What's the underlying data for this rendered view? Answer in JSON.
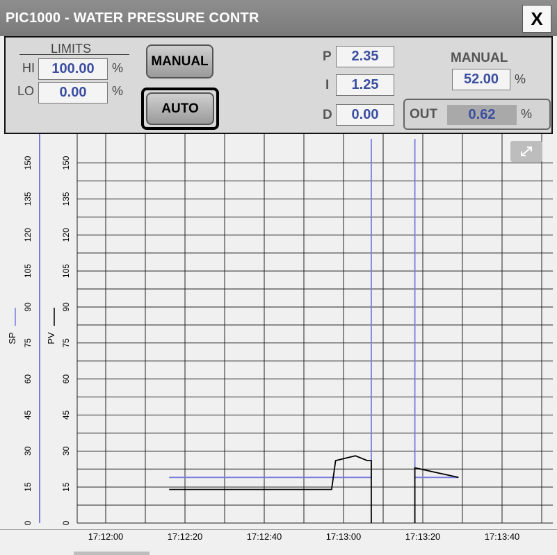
{
  "window": {
    "title": "PIC1000 - WATER PRESSURE CONTR",
    "close_label": "X"
  },
  "limits": {
    "header": "LIMITS",
    "hi_label": "HI",
    "hi_value": "100.00",
    "hi_unit": "%",
    "lo_label": "LO",
    "lo_value": "0.00",
    "lo_unit": "%"
  },
  "mode_buttons": {
    "manual_label": "MANUAL",
    "auto_label": "AUTO",
    "selected": "AUTO"
  },
  "pid": {
    "p_label": "P",
    "p_value": "2.35",
    "i_label": "I",
    "i_value": "1.25",
    "d_label": "D",
    "d_value": "0.00"
  },
  "manual": {
    "label": "MANUAL",
    "value": "52.00",
    "unit": "%"
  },
  "output": {
    "label": "OUT",
    "value": "0.62",
    "unit": "%"
  },
  "chart_data": {
    "type": "line",
    "y_axis_ticks": [
      "0",
      "15",
      "30",
      "45",
      "60",
      "75",
      "90",
      "105",
      "120",
      "135",
      "150"
    ],
    "x_ticks": [
      "17:12:00",
      "17:12:20",
      "17:12:40",
      "17:13:00",
      "17:13:20",
      "17:13:40"
    ],
    "ylim": [
      0,
      160
    ],
    "sp_axis_label": "SP",
    "pv_axis_label": "PV",
    "grid": true,
    "series": [
      {
        "name": "SP",
        "color": "#7b7bdd",
        "points": [
          [
            "17:12:16",
            19
          ],
          [
            "17:13:07",
            19
          ],
          [
            "17:13:07",
            160
          ],
          [
            "17:13:07",
            160
          ]
        ],
        "segments": [
          [
            [
              "17:12:16",
              19
            ],
            [
              "17:13:07",
              19
            ],
            [
              "17:13:07",
              160
            ]
          ],
          [
            [
              "17:13:18",
              160
            ],
            [
              "17:13:18",
              19
            ],
            [
              "17:13:29",
              19
            ]
          ]
        ]
      },
      {
        "name": "PV",
        "color": "#000000",
        "segments": [
          [
            [
              "17:12:16",
              14
            ],
            [
              "17:12:57",
              14
            ],
            [
              "17:12:58",
              26
            ],
            [
              "17:13:03",
              28
            ],
            [
              "17:13:06",
              26
            ],
            [
              "17:13:07",
              26
            ],
            [
              "17:13:07",
              0
            ]
          ],
          [
            [
              "17:13:18",
              0
            ],
            [
              "17:13:18",
              23
            ],
            [
              "17:13:29",
              19
            ]
          ]
        ]
      }
    ]
  }
}
